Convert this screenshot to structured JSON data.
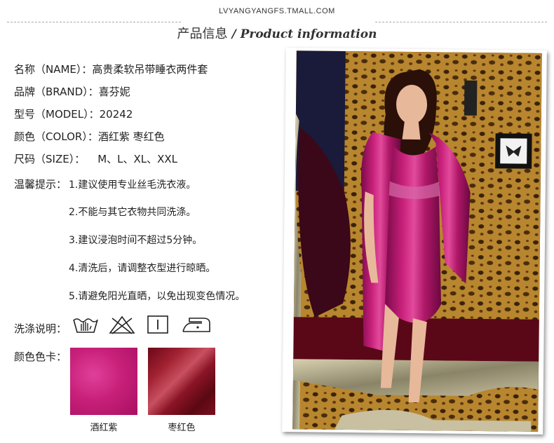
{
  "header": {
    "url": "LVYANGYANGFS.TMALL.COM",
    "title_cn": "产品信息",
    "title_sep": " / ",
    "title_en": "Product information"
  },
  "info": [
    {
      "label": "名称（NAME）：",
      "value": "高贵柔软吊带睡衣两件套"
    },
    {
      "label": "品牌（BRAND）：",
      "value": "喜芬妮"
    },
    {
      "label": "型号（MODEL）：",
      "value": "20242"
    },
    {
      "label": "颜色（COLOR）：",
      "value": "酒红紫  枣红色"
    },
    {
      "label": "尺码（SIZE）：",
      "value": "M、L、XL、XXL"
    }
  ],
  "tips": {
    "label": "温馨提示：",
    "items": [
      "1.建议使用专业丝毛洗衣液。",
      "2.不能与其它衣物共同洗涤。",
      "3.建议浸泡时间不超过5分钟。",
      "4.清洗后，请调整衣型进行晾晒。",
      "5.请避免阳光直晒，以免出现变色情况。"
    ]
  },
  "care": {
    "label": "洗涤说明：",
    "icons": [
      "hand-wash-icon",
      "no-bleach-icon",
      "line-dry-icon",
      "low-iron-icon"
    ]
  },
  "swatches": {
    "label": "颜色色卡：",
    "items": [
      {
        "name": "酒红紫",
        "color": "#c8207a"
      },
      {
        "name": "枣红色",
        "color": "#8a1426"
      }
    ]
  }
}
